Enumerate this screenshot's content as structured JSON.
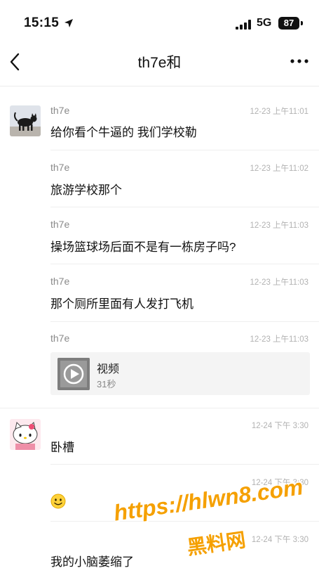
{
  "status_bar": {
    "time": "15:15",
    "network": "5G",
    "battery": "87"
  },
  "nav": {
    "title": "th7e和"
  },
  "messages": [
    {
      "sender": "th7e",
      "time": "12-23 上午11:01",
      "text": "给你看个牛逼的 我们学校勒"
    },
    {
      "sender": "th7e",
      "time": "12-23 上午11:02",
      "text": "旅游学校那个"
    },
    {
      "sender": "th7e",
      "time": "12-23 上午11:03",
      "text": "操场篮球场后面不是有一栋房子吗?"
    },
    {
      "sender": "th7e",
      "time": "12-23 上午11:03",
      "text": "那个厕所里面有人发打飞机"
    },
    {
      "sender": "th7e",
      "time": "12-23 上午11:03"
    },
    {
      "time": "12-24 下午 3:30",
      "text": "卧槽"
    },
    {
      "time": "12-24 下午 3:30",
      "emoji": "smile-emoji"
    },
    {
      "time": "12-24 下午 3:30",
      "text": "我的小脑萎缩了"
    }
  ],
  "video": {
    "title": "视频",
    "duration": "31秒"
  },
  "watermark": {
    "url": "https://hlwn8.com",
    "name": "黑料网"
  },
  "colors": {
    "watermark": "#f5a000",
    "timestamp": "#b2b2b2",
    "sender": "#8a8a8a"
  }
}
